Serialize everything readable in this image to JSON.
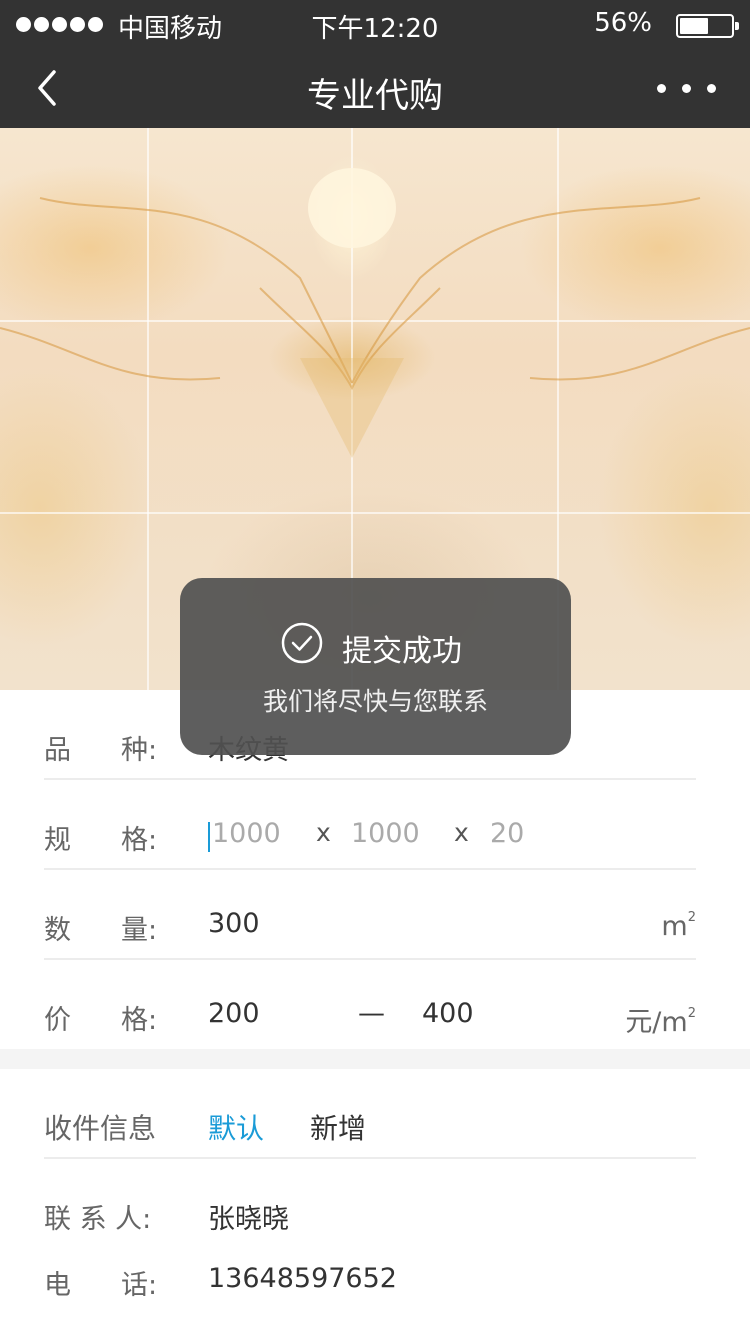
{
  "status": {
    "carrier": "中国移动",
    "time": "下午12:20",
    "battery": "56%",
    "battery_level": 0.56
  },
  "nav": {
    "title": "专业代购",
    "back_icon": "chevron-left-icon",
    "more_icon": "more-dots-icon"
  },
  "hero": {
    "image": "marble-tile-image"
  },
  "form": {
    "variety": {
      "label_a": "品",
      "label_b": "种:",
      "value": "木纹黄"
    },
    "spec": {
      "label_a": "规",
      "label_b": "格:",
      "length_placeholder": "1000",
      "width_placeholder": "1000",
      "thickness_placeholder": "20",
      "sep": "x"
    },
    "quantity": {
      "label_a": "数",
      "label_b": "量:",
      "value": "300",
      "unit": "m",
      "unit_sup": "2"
    },
    "price": {
      "label_a": "价",
      "label_b": "格:",
      "min": "200",
      "dash": "—",
      "max": "400",
      "unit": "元/m",
      "unit_sup": "2"
    }
  },
  "address": {
    "label": "收件信息",
    "option_default": "默认",
    "option_new": "新增",
    "contact_label": "联 系 人:",
    "contact": "张晓晓",
    "phone_label_a": "电",
    "phone_label_b": "话:",
    "phone": "13648597652"
  },
  "toast": {
    "icon": "check-circle-icon",
    "title": "提交成功",
    "message": "我们将尽快与您联系"
  },
  "colors": {
    "bar": "#333333",
    "accent": "#1a9bd7",
    "toast": "#505050"
  }
}
